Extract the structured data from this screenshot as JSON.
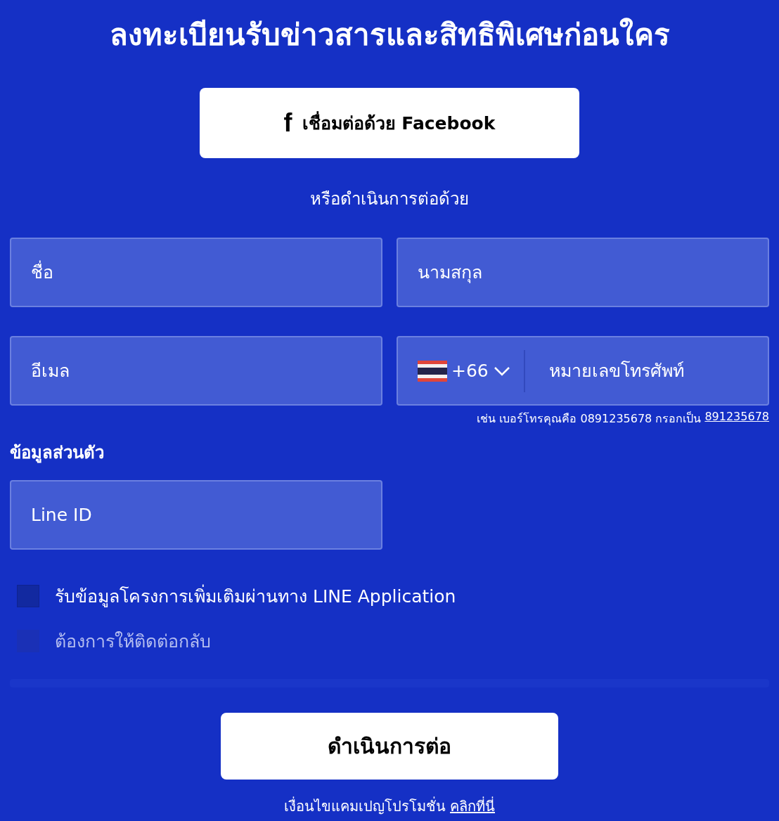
{
  "title": "ลงทะเบียนรับข่าวสารและสิทธิพิเศษก่อนใคร",
  "facebook_button": {
    "icon": "f",
    "label": "เชื่อมต่อด้วย Facebook"
  },
  "divider_text": "หรือดำเนินการต่อด้วย",
  "fields": [
    {
      "placeholder": "ชื่อ"
    },
    {
      "placeholder": "นามสกุล"
    },
    {
      "placeholder": "อีเมล"
    }
  ],
  "phone": {
    "country_code": "+66",
    "placeholder": "หมายเลขโทรศัพท์",
    "hint": "เช่น เบอร์โทรคุณคือ 0891235678 กรอกเป็น",
    "hint_link": "891235678"
  },
  "section_label": "ข้อมูลส่วนตัว",
  "line_id": {
    "placeholder": "Line ID"
  },
  "checkboxes": [
    {
      "label": "รับข้อมูลโครงการเพิ่มเติมผ่านทาง LINE Application",
      "checked": false,
      "disabled": false
    },
    {
      "label": "ต้องการให้ติดต่อกลับ",
      "checked": false,
      "disabled": true
    }
  ],
  "continue_button": "ดำเนินการต่อ",
  "footer": {
    "text": "เงื่อนไขแคมเปญโปรโมชั่น",
    "link": "คลิกที่นี่"
  }
}
